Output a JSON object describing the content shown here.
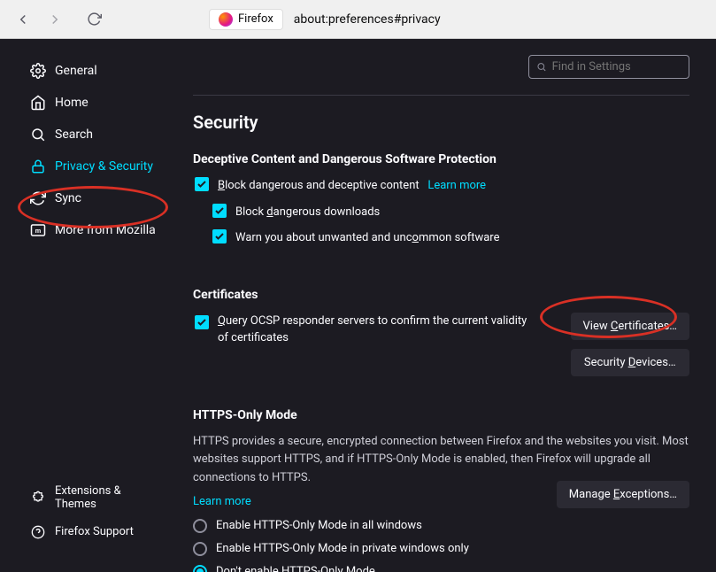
{
  "chrome": {
    "identity_label": "Firefox",
    "url": "about:preferences#privacy"
  },
  "search": {
    "placeholder": "Find in Settings"
  },
  "sidebar": {
    "items": [
      {
        "label": "General"
      },
      {
        "label": "Home"
      },
      {
        "label": "Search"
      },
      {
        "label": "Privacy & Security"
      },
      {
        "label": "Sync"
      },
      {
        "label": "More from Mozilla"
      }
    ],
    "bottom": [
      {
        "label": "Extensions & Themes"
      },
      {
        "label": "Firefox Support"
      }
    ]
  },
  "main": {
    "heading": "Security",
    "deceptive": {
      "title": "Deceptive Content and Dangerous Software Protection",
      "block_content": "lock dangerous and deceptive content",
      "block_content_prefix": "B",
      "learn_more": "Learn more",
      "block_downloads": "Block ",
      "block_downloads_u": "d",
      "block_downloads_rest": "angerous downloads",
      "warn_uncommon": "Warn you about unwanted and unc",
      "warn_uncommon_u": "o",
      "warn_uncommon_rest": "mmon software"
    },
    "certificates": {
      "title": "Certificates",
      "ocsp": "uery OCSP responder servers to confirm the current validity of certificates",
      "ocsp_prefix": "Q",
      "view_btn": "View ",
      "view_btn_u": "C",
      "view_btn_rest": "ertificates…",
      "devices_btn": "Security ",
      "devices_btn_u": "D",
      "devices_btn_rest": "evices…"
    },
    "https": {
      "title": "HTTPS-Only Mode",
      "desc": "HTTPS provides a secure, encrypted connection between Firefox and the websites you visit. Most websites support HTTPS, and if HTTPS-Only Mode is enabled, then Firefox will upgrade all connections to HTTPS.",
      "learn_more": "Learn more",
      "opt_all": "Enable HTTPS-Only Mode in all windows",
      "opt_private": "Enable HTTPS-Only Mode in private windows only",
      "opt_off": "Don't enable HTTPS-Only Mode",
      "manage_btn": "Manage ",
      "manage_btn_u": "E",
      "manage_btn_rest": "xceptions…"
    }
  }
}
